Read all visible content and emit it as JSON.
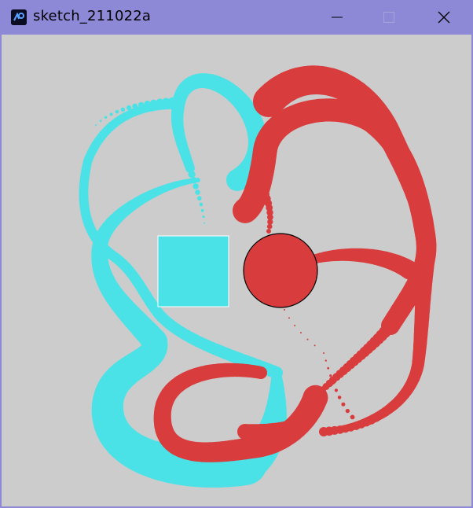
{
  "window": {
    "title": "sketch_211022a",
    "icons": {
      "app": "processing-app-icon",
      "minimize": "minimize-icon",
      "maximize": "maximize-icon",
      "close": "close-icon"
    }
  },
  "sketch": {
    "background": "#cccccc",
    "colors": {
      "cyan": "#4ae2e6",
      "red": "#d93c3c"
    },
    "square": {
      "fill": "#4ae2e6",
      "stroke": "#ffffff"
    },
    "circle": {
      "fill": "#d93c3c",
      "stroke": "#000000"
    }
  }
}
